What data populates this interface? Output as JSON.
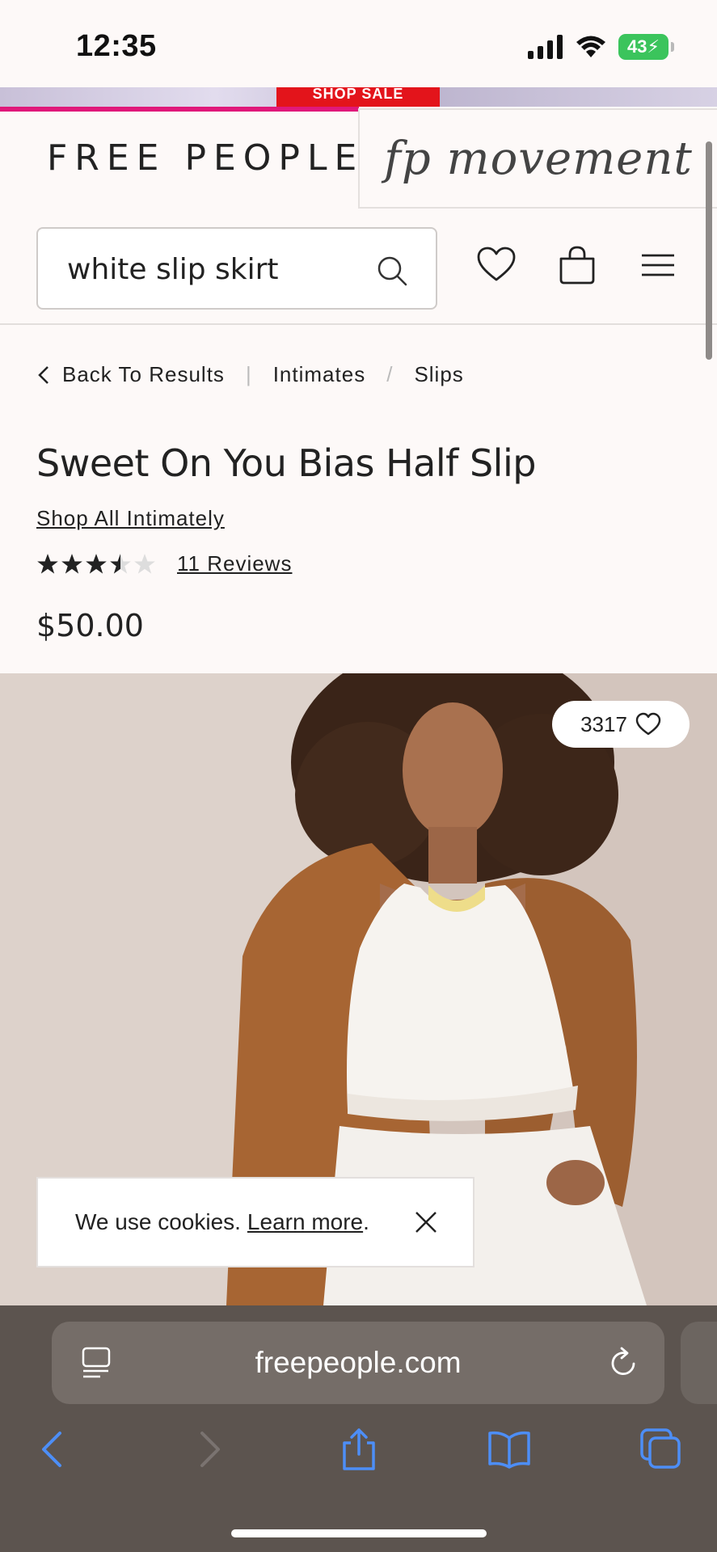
{
  "status_bar": {
    "time": "12:35",
    "battery": "43"
  },
  "promo": {
    "button_label": "SHOP SALE"
  },
  "header": {
    "brand": "FREE PEOPLE",
    "movement_logo": "fp movement",
    "search": {
      "value": "white slip skirt"
    }
  },
  "breadcrumb": {
    "back": "Back To Results",
    "items": [
      "Intimates",
      "Slips"
    ]
  },
  "product": {
    "title": "Sweet On You Bias Half Slip",
    "shop_all": "Shop All Intimately",
    "rating": 3.5,
    "rating_max": 5,
    "reviews": "11 Reviews",
    "price": "$50.00",
    "wishlist_count": "3317"
  },
  "cookie": {
    "text": "We use cookies.",
    "link": "Learn more",
    "suffix": "."
  },
  "browser": {
    "url": "freepeople.com"
  },
  "colors": {
    "accent_red": "#e3141b",
    "accent_pink": "#e0187a",
    "safari_blue": "#4d8ef7"
  }
}
